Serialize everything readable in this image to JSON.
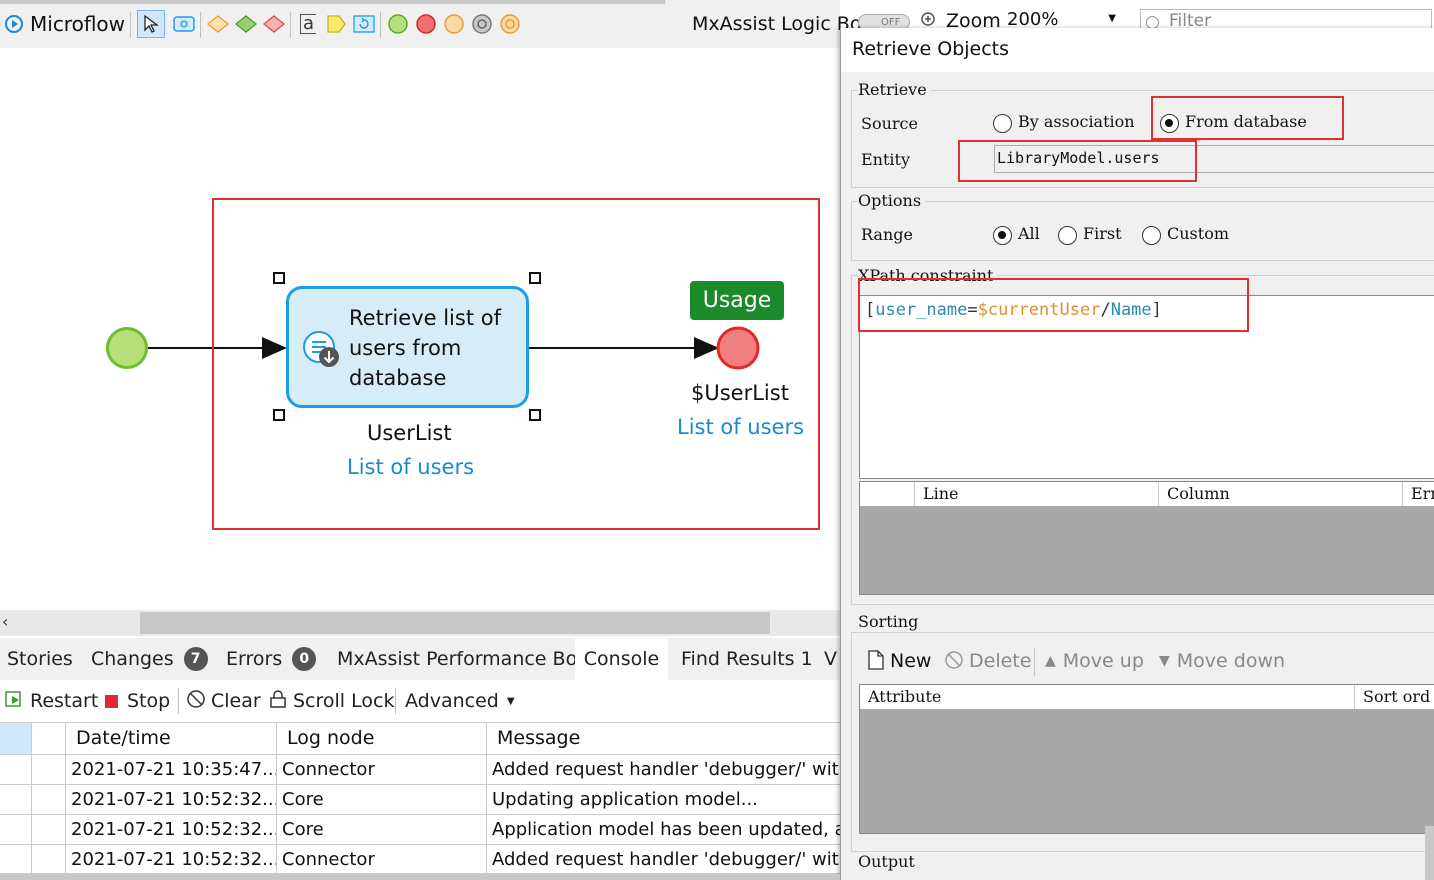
{
  "toolbar": {
    "title": "Microflow",
    "bot_label": "MxAssist Logic Bot",
    "bot_toggle": "OFF",
    "zoom_label": "Zoom",
    "zoom_value": "200%",
    "filter_placeholder": "Filter"
  },
  "flow": {
    "activity_text": [
      "Retrieve list of",
      "users from",
      "database"
    ],
    "activity_var": "UserList",
    "activity_type": "List of users",
    "usage_badge": "Usage",
    "end_var": "$UserList",
    "end_type": "List of users"
  },
  "tabs": [
    {
      "label": "Stories"
    },
    {
      "label": "Changes",
      "badge": "7"
    },
    {
      "label": "Errors",
      "badge": "0"
    },
    {
      "label": "MxAssist Performance Bot"
    },
    {
      "label": "Console",
      "active": true
    },
    {
      "label": "Find Results 1"
    },
    {
      "label": "V"
    }
  ],
  "console_toolbar": {
    "restart": "Restart",
    "stop": "Stop",
    "clear": "Clear",
    "scroll_lock": "Scroll Lock",
    "advanced": "Advanced"
  },
  "console": {
    "columns": [
      "Date/time",
      "Log node",
      "Message"
    ],
    "rows": [
      [
        "2021-07-21 10:35:47....",
        "Connector",
        "Added request handler 'debugger/' with"
      ],
      [
        "2021-07-21 10:52:32....",
        "Core",
        "Updating application model..."
      ],
      [
        "2021-07-21 10:52:32....",
        "Core",
        "Application model has been updated, ap"
      ],
      [
        "2021-07-21 10:52:32....",
        "Connector",
        "Added request handler 'debugger/' with"
      ]
    ]
  },
  "dialog": {
    "title": "Retrieve Objects",
    "retrieve_group": "Retrieve",
    "source_label": "Source",
    "source_options": [
      "By association",
      "From database"
    ],
    "source_selected": "From database",
    "entity_label": "Entity",
    "entity_value": "LibraryModel.users",
    "options_group": "Options",
    "range_label": "Range",
    "range_options": [
      "All",
      "First",
      "Custom"
    ],
    "range_selected": "All",
    "xpath_group": "XPath constraint",
    "xpath_open": "[",
    "xpath_attr": "user_name",
    "xpath_eq": "=",
    "xpath_var": "$currentUser",
    "xpath_slash": "/",
    "xpath_member": "Name",
    "xpath_close": "]",
    "error_columns": [
      "Line",
      "Column",
      "Err"
    ],
    "sorting_group": "Sorting",
    "sort_buttons": {
      "new": "New",
      "delete": "Delete",
      "move_up": "Move up",
      "move_down": "Move down"
    },
    "sort_columns": [
      "Attribute",
      "Sort ord"
    ],
    "output_group": "Output"
  },
  "colors": {
    "highlight_red": "#e03030",
    "activity_fill": "#d6ecf8",
    "activity_border": "#1a9ee8",
    "start_green": "#b8e07a",
    "end_red": "#f08080",
    "usage_green": "#1a8a2a",
    "link_blue": "#1a8ad0",
    "xpath_attr": "#2a8ab0",
    "xpath_var": "#e0902a"
  }
}
